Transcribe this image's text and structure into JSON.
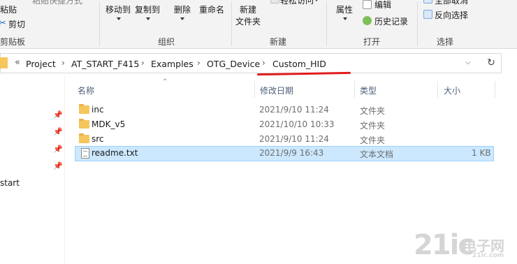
{
  "ribbon": {
    "clipboard": {
      "paste_shortcut": "粘贴快捷方式",
      "paste": "粘贴",
      "cut": "剪切",
      "group": "剪贴板"
    },
    "organize": {
      "move_to": "移动到",
      "copy_to": "复制到",
      "delete": "删除",
      "rename": "重命名",
      "group": "组织"
    },
    "new": {
      "new_folder_top": "新建",
      "new_folder_bottom": "文件夹",
      "easy_access": "轻松访问",
      "group": "新建"
    },
    "open": {
      "properties": "属性",
      "edit": "编辑",
      "history": "历史记录",
      "group": "打开"
    },
    "select": {
      "select_none": "全部取消",
      "invert": "反向选择",
      "group": "选择"
    }
  },
  "address_bar": {
    "overflow": "«",
    "crumbs": [
      "Project",
      "AT_START_F415",
      "Examples",
      "OTG_Device",
      "Custom_HID"
    ],
    "refresh_icon": "refresh-icon",
    "annotation_color": "#e11c1c"
  },
  "nav": {
    "partial_item": "start"
  },
  "columns": {
    "name": "名称",
    "modified": "修改日期",
    "type": "类型",
    "size": "大小"
  },
  "files": [
    {
      "name": "inc",
      "modified": "2021/9/10 11:24",
      "type": "文件夹",
      "size": "",
      "icon": "folder-icon",
      "selected": false
    },
    {
      "name": "MDK_v5",
      "modified": "2021/10/10 10:33",
      "type": "文件夹",
      "size": "",
      "icon": "folder-icon",
      "selected": false
    },
    {
      "name": "src",
      "modified": "2021/9/10 11:24",
      "type": "文件夹",
      "size": "",
      "icon": "folder-icon",
      "selected": false
    },
    {
      "name": "readme.txt",
      "modified": "2021/9/9 16:43",
      "type": "文本文档",
      "size": "1 KB",
      "icon": "text-file-icon",
      "selected": true
    }
  ],
  "watermark": {
    "number": "21ic",
    "text": "电子网",
    "domain": "21ic.com"
  },
  "colors": {
    "selection_bg": "#cce8ff",
    "selection_border": "#99d1ff",
    "folder": "#f5c65c"
  }
}
